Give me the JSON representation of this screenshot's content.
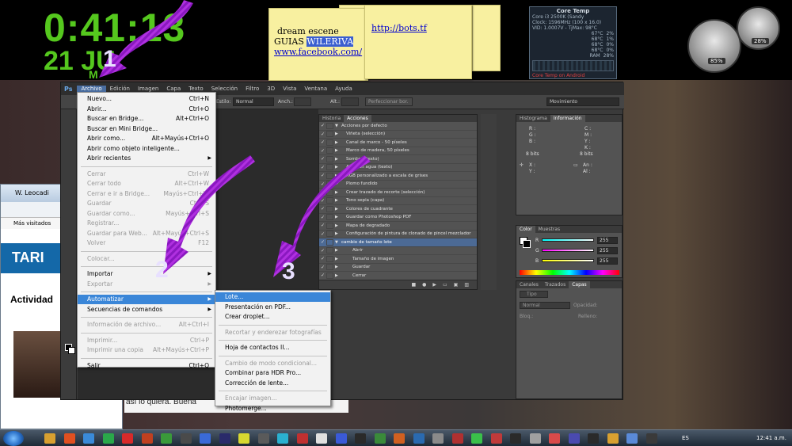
{
  "clock": {
    "time": "0:41:13",
    "date": "21 JU",
    "month": "M"
  },
  "notes": {
    "note1_line1": "dream escene",
    "note1_line2_plain": "GUIAS ",
    "note1_line2_hl": "WILERIVA",
    "note1_link": "www.facebook.com/",
    "note3_link": "http://bots.tf"
  },
  "core_temp": {
    "title": "Core Temp",
    "lines": [
      "Core i3 2500K (Sandy",
      "Clock: 1596MHz (100 x 16.0)",
      "VID: 1.0007V - TjMax: 98°C"
    ],
    "temps": [
      "67°C",
      "68°C",
      "68°C",
      "68°C"
    ],
    "loads": [
      "2%",
      "1%",
      "0%",
      "0%"
    ],
    "ram_label": "RAM",
    "ram": "28%",
    "footer": "Core Temp on Android"
  },
  "gauges": {
    "cpu": "85%",
    "ram": "28%"
  },
  "browser": {
    "tab": "W. Leocadi",
    "bookmarks": "Más visitados",
    "banner": "TARI",
    "heading": "Actividad",
    "caption": "así lo quiera. Buena"
  },
  "photoshop": {
    "logo": "Ps",
    "menus": [
      "Archivo",
      "Edición",
      "Imagen",
      "Capa",
      "Texto",
      "Selección",
      "Filtro",
      "3D",
      "Vista",
      "Ventana",
      "Ayuda"
    ],
    "options": {
      "style_label": "Estilo:",
      "style_value": "Normal",
      "width_label": "Anch.:",
      "height_label": "Alt.:",
      "refine": "Perfeccionar bor.",
      "workspace": "Movimiento"
    },
    "actions_panel": {
      "tabs": [
        "Historia",
        "Acciones"
      ],
      "rows": [
        {
          "level": 0,
          "label": "Acciones por defecto",
          "state": "set"
        },
        {
          "level": 1,
          "label": "Viñeta (selección)"
        },
        {
          "level": 1,
          "label": "Canal de marco - 50 píxeles"
        },
        {
          "level": 1,
          "label": "Marco de madera, 50 píxeles"
        },
        {
          "level": 1,
          "label": "Sombra (texto)"
        },
        {
          "level": 1,
          "label": "Agua en agua (texto)"
        },
        {
          "level": 1,
          "label": "RGB personalizado a escala de grises"
        },
        {
          "level": 1,
          "label": "Plomo fundido"
        },
        {
          "level": 1,
          "label": "Crear trazado de recorte (selección)"
        },
        {
          "level": 1,
          "label": "Tono sepia (capa)"
        },
        {
          "level": 1,
          "label": "Colores de cuadrante"
        },
        {
          "level": 1,
          "label": "Guardar como Photoshop PDF"
        },
        {
          "level": 1,
          "label": "Mapa de degradado"
        },
        {
          "level": 1,
          "label": "Configuración de pintura de clonado de pincel mezclador"
        },
        {
          "level": 0,
          "label": "cambio de tamaño lote",
          "state": "selected"
        },
        {
          "level": 2,
          "label": "Abrir"
        },
        {
          "level": 2,
          "label": "Tamaño de imagen"
        },
        {
          "level": 2,
          "label": "Guardar"
        },
        {
          "level": 2,
          "label": "Cerrar"
        }
      ]
    },
    "info_panel": {
      "tabs": [
        "Histograma",
        "Información"
      ],
      "r": "R :",
      "g": "G :",
      "b": "B :",
      "c": "C :",
      "m": "M :",
      "y": "Y :",
      "k": "K :",
      "bits_left": "8 bits",
      "bits_right": "8 bits",
      "x": "X :",
      "y_coord": "Y :",
      "an": "An :",
      "al": "Al :"
    },
    "color_panel": {
      "tabs": [
        "Color",
        "Muestras"
      ],
      "r_label": "R",
      "g_label": "G",
      "b_label": "B",
      "r": "255",
      "g": "255",
      "b": "255"
    },
    "layers_panel": {
      "tabs": [
        "Canales",
        "Trazados",
        "Capas"
      ],
      "kind": "Tipo",
      "blend": "Normal",
      "opacity_label": "Opacidad:",
      "fill_label": "Relleno:",
      "lock_label": "Bloq.:"
    }
  },
  "file_menu": {
    "items": [
      {
        "label": "Nuevo...",
        "shortcut": "Ctrl+N"
      },
      {
        "label": "Abrir...",
        "shortcut": "Ctrl+O"
      },
      {
        "label": "Buscar en Bridge...",
        "shortcut": "Alt+Ctrl+O"
      },
      {
        "label": "Buscar en Mini Bridge..."
      },
      {
        "label": "Abrir como...",
        "shortcut": "Alt+Mayús+Ctrl+O"
      },
      {
        "label": "Abrir como objeto inteligente..."
      },
      {
        "label": "Abrir recientes",
        "submenu": true
      },
      {
        "label": "Cerrar",
        "shortcut": "Ctrl+W",
        "disabled": true
      },
      {
        "label": "Cerrar todo",
        "shortcut": "Alt+Ctrl+W",
        "disabled": true
      },
      {
        "label": "Cerrar e ir a Bridge...",
        "shortcut": "Mayús+Ctrl+W",
        "disabled": true
      },
      {
        "label": "Guardar",
        "shortcut": "Ctrl+S",
        "disabled": true
      },
      {
        "label": "Guardar como...",
        "shortcut": "Mayús+Ctrl+S",
        "disabled": true
      },
      {
        "label": "Registrar...",
        "disabled": true
      },
      {
        "label": "Guardar para Web...",
        "shortcut": "Alt+Mayús+Ctrl+S",
        "disabled": true
      },
      {
        "label": "Volver",
        "shortcut": "F12",
        "disabled": true
      },
      {
        "label": "Colocar...",
        "disabled": true
      },
      {
        "label": "Importar",
        "submenu": true
      },
      {
        "label": "Exportar",
        "submenu": true,
        "disabled": true
      },
      {
        "label": "Automatizar",
        "submenu": true,
        "highlighted": true
      },
      {
        "label": "Secuencias de comandos",
        "submenu": true
      },
      {
        "label": "Información de archivo...",
        "shortcut": "Alt+Ctrl+I",
        "disabled": true
      },
      {
        "label": "Imprimir...",
        "shortcut": "Ctrl+P",
        "disabled": true
      },
      {
        "label": "Imprimir una copia",
        "shortcut": "Alt+Mayús+Ctrl+P",
        "disabled": true
      },
      {
        "label": "Salir",
        "shortcut": "Ctrl+Q"
      }
    ]
  },
  "automate_menu": {
    "items": [
      {
        "label": "Lote...",
        "highlighted": true
      },
      {
        "label": "Presentación en PDF..."
      },
      {
        "label": "Crear droplet..."
      },
      {
        "label": "Recortar y enderezar fotografías",
        "disabled": true
      },
      {
        "label": "Hoja de contactos II..."
      },
      {
        "label": "Cambio de modo condicional...",
        "disabled": true
      },
      {
        "label": "Combinar para HDR Pro..."
      },
      {
        "label": "Corrección de lente..."
      },
      {
        "label": "Encajar imagen...",
        "disabled": true
      },
      {
        "label": "Photomerge..."
      }
    ]
  },
  "annotations": [
    "1",
    "2",
    "3"
  ],
  "taskbar": {
    "lang": "ES",
    "time": "12:41 a.m."
  },
  "colors": {
    "accent": "#3a86d8",
    "clock_green": "#55c81e",
    "arrow_purple": "#b030e0",
    "ps_selected": "#4c6a95"
  }
}
